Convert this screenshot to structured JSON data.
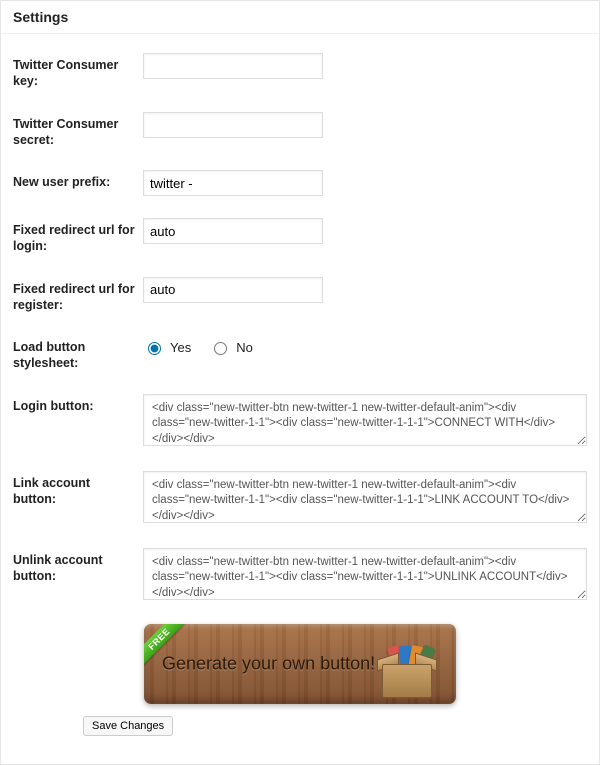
{
  "panel": {
    "title": "Settings"
  },
  "fields": {
    "consumer_key": {
      "label": "Twitter Consumer key:",
      "value": ""
    },
    "consumer_secret": {
      "label": "Twitter Consumer secret:",
      "value": ""
    },
    "new_user_prefix": {
      "label": "New user prefix:",
      "value": "twitter -"
    },
    "redirect_login": {
      "label": "Fixed redirect url for login:",
      "value": "auto"
    },
    "redirect_register": {
      "label": "Fixed redirect url for register:",
      "value": "auto"
    },
    "load_stylesheet": {
      "label": "Load button stylesheet:",
      "options": {
        "yes": "Yes",
        "no": "No"
      },
      "selected": "yes"
    },
    "login_button": {
      "label": "Login button:",
      "value": "<div class=\"new-twitter-btn new-twitter-1 new-twitter-default-anim\"><div class=\"new-twitter-1-1\"><div class=\"new-twitter-1-1-1\">CONNECT WITH</div></div></div>"
    },
    "link_account_button": {
      "label": "Link account button:",
      "value": "<div class=\"new-twitter-btn new-twitter-1 new-twitter-default-anim\"><div class=\"new-twitter-1-1\"><div class=\"new-twitter-1-1-1\">LINK ACCOUNT TO</div></div></div>"
    },
    "unlink_account_button": {
      "label": "Unlink account button:",
      "value": "<div class=\"new-twitter-btn new-twitter-1 new-twitter-default-anim\"><div class=\"new-twitter-1-1\"><div class=\"new-twitter-1-1-1\">UNLINK ACCOUNT</div></div></div>"
    }
  },
  "banner": {
    "tag": "FREE",
    "text": "Generate your own button!"
  },
  "actions": {
    "save": "Save Changes"
  }
}
